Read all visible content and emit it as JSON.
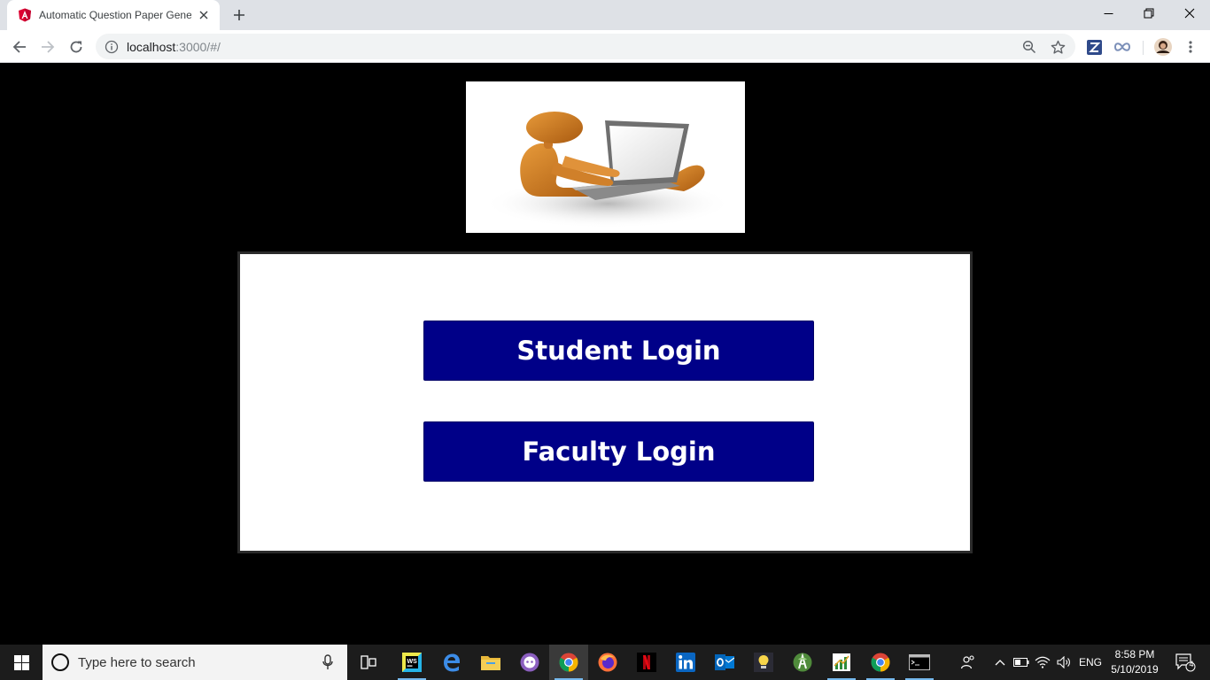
{
  "browser": {
    "tab": {
      "title": "Automatic Question Paper Generator",
      "favicon": "angular-icon"
    },
    "address_bar": {
      "host": "localhost",
      "rest": ":3000/#/"
    },
    "extensions": [
      "zotero-icon",
      "infinity-icon",
      "profile-avatar"
    ]
  },
  "page": {
    "hero_image": "person-with-laptop-illustration",
    "buttons": {
      "student_login": "Student Login",
      "faculty_login": "Faculty Login"
    },
    "colors": {
      "background": "#000000",
      "button": "#000088",
      "panel": "#ffffff"
    }
  },
  "taskbar": {
    "search_placeholder": "Type here to search",
    "apps": [
      "task-view-icon",
      "webstorm-icon",
      "edge-icon",
      "file-explorer-icon",
      "github-desktop-icon",
      "chrome-icon",
      "firefox-icon",
      "netflix-icon",
      "linkedin-icon",
      "outlook-icon",
      "bulb-icon",
      "android-studio-icon",
      "chart-app-icon",
      "chrome-icon",
      "terminal-icon"
    ],
    "language": "ENG",
    "time": "8:58 PM",
    "date": "5/10/2019",
    "notifications": "4"
  }
}
